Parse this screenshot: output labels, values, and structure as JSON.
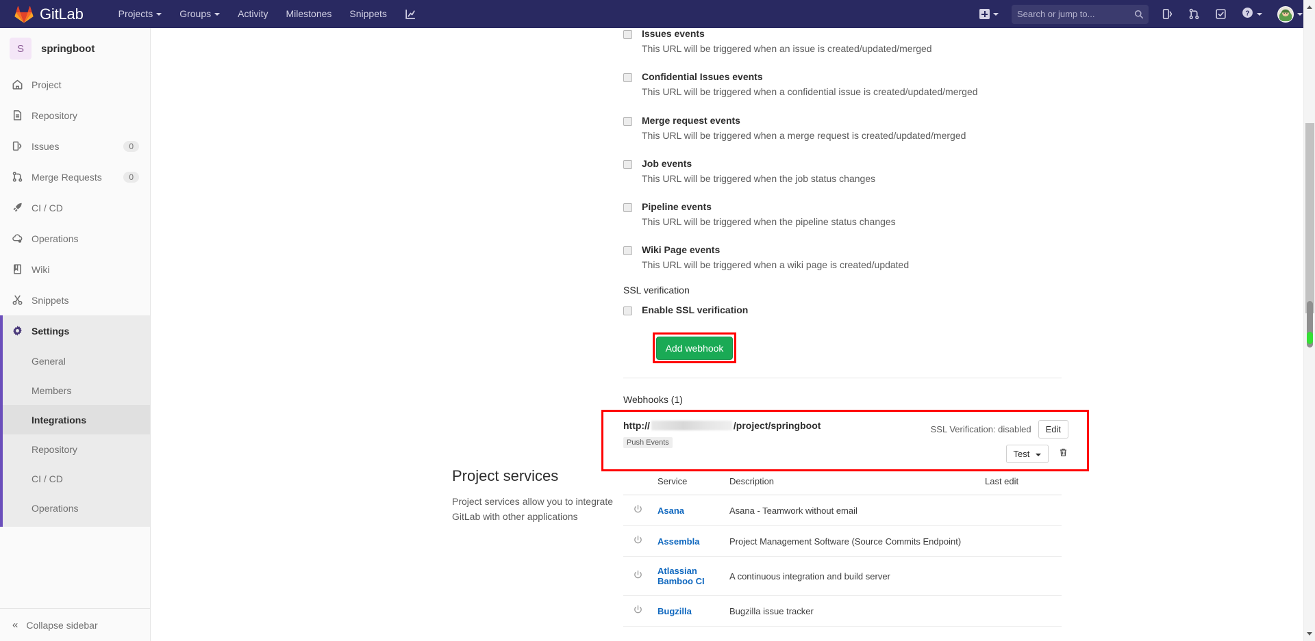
{
  "navbar": {
    "brand": "GitLab",
    "links": [
      {
        "label": "Projects",
        "caret": true
      },
      {
        "label": "Groups",
        "caret": true
      },
      {
        "label": "Activity",
        "caret": false
      },
      {
        "label": "Milestones",
        "caret": false
      },
      {
        "label": "Snippets",
        "caret": false
      }
    ],
    "chart_icon": "analytics-icon",
    "new_icon": "plus-square-icon",
    "search": {
      "placeholder": "Search or jump to...",
      "value": ""
    },
    "right_icons": [
      {
        "name": "issues-icon"
      },
      {
        "name": "merge-requests-icon"
      },
      {
        "name": "todos-icon"
      },
      {
        "name": "help-icon"
      }
    ],
    "colors": {
      "navbar_bg": "#292961",
      "accent": "#6b4fbb"
    }
  },
  "sidebar": {
    "project": {
      "initial": "S",
      "name": "springboot"
    },
    "items": [
      {
        "label": "Project",
        "icon": "home-icon",
        "badge": ""
      },
      {
        "label": "Repository",
        "icon": "doc-icon",
        "badge": ""
      },
      {
        "label": "Issues",
        "icon": "issues-icon",
        "badge": "0"
      },
      {
        "label": "Merge Requests",
        "icon": "merge-icon",
        "badge": "0"
      },
      {
        "label": "CI / CD",
        "icon": "rocket-icon",
        "badge": ""
      },
      {
        "label": "Operations",
        "icon": "cloud-gear-icon",
        "badge": ""
      },
      {
        "label": "Wiki",
        "icon": "book-icon",
        "badge": ""
      },
      {
        "label": "Snippets",
        "icon": "scissors-icon",
        "badge": ""
      }
    ],
    "settings": {
      "label": "Settings",
      "icon": "gear-icon",
      "sub_items": [
        {
          "label": "General",
          "active": false
        },
        {
          "label": "Members",
          "active": false
        },
        {
          "label": "Integrations",
          "active": true
        },
        {
          "label": "Repository",
          "active": false
        },
        {
          "label": "CI / CD",
          "active": false
        },
        {
          "label": "Operations",
          "active": false
        }
      ]
    },
    "collapse_label": "Collapse sidebar"
  },
  "main": {
    "events": [
      {
        "title": "Issues events",
        "desc": "This URL will be triggered when an issue is created/updated/merged",
        "checked": false
      },
      {
        "title": "Confidential Issues events",
        "desc": "This URL will be triggered when a confidential issue is created/updated/merged",
        "checked": false
      },
      {
        "title": "Merge request events",
        "desc": "This URL will be triggered when a merge request is created/updated/merged",
        "checked": false
      },
      {
        "title": "Job events",
        "desc": "This URL will be triggered when the job status changes",
        "checked": false
      },
      {
        "title": "Pipeline events",
        "desc": "This URL will be triggered when the pipeline status changes",
        "checked": false
      },
      {
        "title": "Wiki Page events",
        "desc": "This URL will be triggered when a wiki page is created/updated",
        "checked": false
      }
    ],
    "ssl_section_label": "SSL verification",
    "ssl_checkbox_label": "Enable SSL verification",
    "add_webhook_button": "Add webhook",
    "webhooks_heading": "Webhooks (1)",
    "webhook": {
      "url_prefix": "http://",
      "url_redacted": true,
      "url_suffix": "/project/springboot",
      "tag": "Push Events",
      "ssl_status": "SSL Verification: disabled",
      "edit_label": "Edit",
      "test_label": "Test",
      "delete_icon": "trash-icon"
    },
    "project_services": {
      "title": "Project services",
      "description": "Project services allow you to integrate GitLab with other applications",
      "columns": [
        "",
        "Service",
        "Description",
        "Last edit"
      ],
      "rows": [
        {
          "icon": "power-icon",
          "service": "Asana",
          "description": "Asana - Teamwork without email",
          "last_edit": ""
        },
        {
          "icon": "power-icon",
          "service": "Assembla",
          "description": "Project Management Software (Source Commits Endpoint)",
          "last_edit": ""
        },
        {
          "icon": "power-icon",
          "service": "Atlassian Bamboo CI",
          "description": "A continuous integration and build server",
          "last_edit": ""
        },
        {
          "icon": "power-icon",
          "service": "Bugzilla",
          "description": "Bugzilla issue tracker",
          "last_edit": ""
        }
      ]
    },
    "highlight_color": "#ff0000",
    "button_color": "#1aaa55"
  }
}
